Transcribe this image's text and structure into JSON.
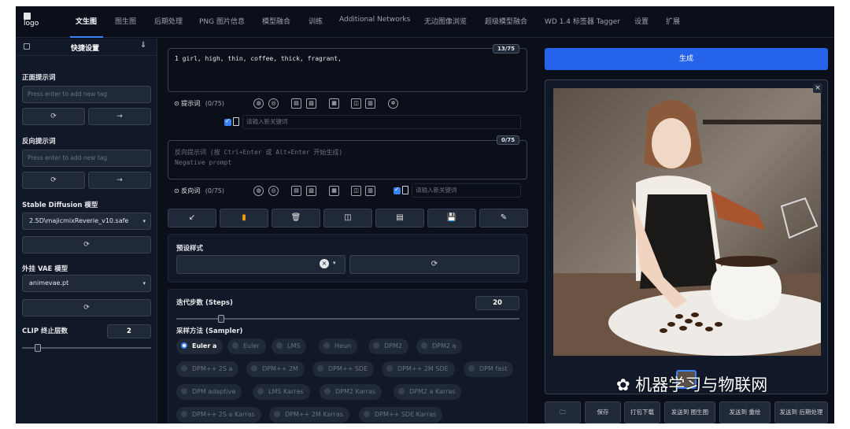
{
  "nav": {
    "logo": "logo",
    "tabs": [
      "文生图",
      "图生图",
      "后期处理",
      "PNG 图片信息",
      "模型融合",
      "训练",
      "Additional Networks",
      "无边图像浏览",
      "超级模型融合",
      "WD 1.4 标签器 Tagger",
      "设置",
      "扩展"
    ],
    "active_tab": "文生图"
  },
  "sidebar": {
    "title": "快捷设置",
    "positive_label": "正面提示词",
    "positive_placeholder": "Press enter to add new tag",
    "negative_label": "反向提示词",
    "negative_placeholder": "Press enter to add new tag",
    "model_label": "Stable Diffusion 模型",
    "model_value": "2.5D\\majicmixReverie_v10.safe",
    "vae_label": "外挂 VAE 模型",
    "vae_value": "animevae.pt",
    "clip_label": "CLIP 终止层数",
    "clip_value": "2",
    "clip_slider_fraction": 0.12
  },
  "prompt": {
    "text": "1 girl, high, thin, coffee, thick, fragrant,",
    "counter": "13/75",
    "toolbar_label": "提示词",
    "toolbar_count": "(0/75)",
    "tag_placeholder": "请输入新关键词"
  },
  "negative": {
    "placeholder_line1": "反向提示词 (按 Ctrl+Enter 或 Alt+Enter 开始生成)",
    "placeholder_line2": "Negative prompt",
    "counter": "0/75",
    "toolbar_label": "反向词",
    "toolbar_count": "(0/75)",
    "tag_placeholder": "请输入新关键词"
  },
  "actions": [
    "↙",
    "▮",
    "🗑",
    "◫",
    "▤",
    "💾",
    "✎"
  ],
  "styles": {
    "label": "预设样式"
  },
  "steps": {
    "label": "迭代步数 (Steps)",
    "value": "20",
    "slider_fraction": 0.13
  },
  "sampler": {
    "label": "采样方法 (Sampler)",
    "options": [
      "Euler a",
      "Euler",
      "LMS",
      "Heun",
      "DPM2",
      "DPM2 a",
      "DPM++ 2S a",
      "DPM++ 2M",
      "DPM++ SDE",
      "DPM++ 2M SDE",
      "DPM fast",
      "DPM adaptive",
      "LMS Karras",
      "DPM2 Karras",
      "DPM2 a Karras",
      "DPM++ 2S a Karras",
      "DPM++ 2M Karras",
      "DPM++ SDE Karras"
    ],
    "selected": "Euler a"
  },
  "output": {
    "generate_label": "生成",
    "buttons": [
      "🗀",
      "保存",
      "打包下载",
      "发送到 图生图",
      "发送到 重绘",
      "发送到 后期处理"
    ],
    "close": "×"
  },
  "watermark": "机器学习与物联网",
  "colors": {
    "background": "#0b0f19",
    "panel": "#111827",
    "accent": "#2563eb"
  }
}
